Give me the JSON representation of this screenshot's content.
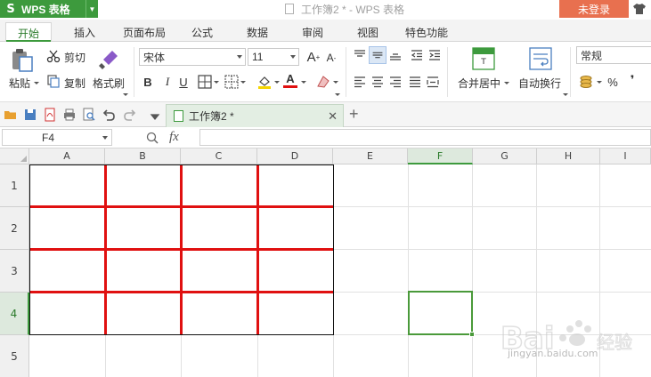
{
  "titlebar": {
    "app_name": "WPS 表格",
    "doc_title": "工作簿2 * - WPS 表格",
    "login_label": "未登录"
  },
  "menu": {
    "tabs": [
      "开始",
      "插入",
      "页面布局",
      "公式",
      "数据",
      "审阅",
      "视图",
      "特色功能"
    ],
    "active_index": 0
  },
  "ribbon": {
    "paste_label": "粘贴",
    "cut_label": "剪切",
    "copy_label": "复制",
    "format_painter_label": "格式刷",
    "font_name": "宋体",
    "font_size": "11",
    "bold": "B",
    "italic": "I",
    "underline": "U",
    "grow_font": "A",
    "shrink_font": "A",
    "merge_label": "合并居中",
    "wrap_label": "自动换行",
    "number_format": "常规",
    "percent": "%",
    "comma": "❜",
    "font_color": "#e01010",
    "fill_color": "#f5d500"
  },
  "doc_tabs": [
    {
      "label": "工作簿2 *",
      "active": true
    }
  ],
  "formula_bar": {
    "name_box": "F4",
    "fx_label": "fx",
    "formula": ""
  },
  "sheet": {
    "columns": [
      "A",
      "B",
      "C",
      "D",
      "E",
      "F",
      "G",
      "H",
      "I"
    ],
    "rows": [
      "1",
      "2",
      "3",
      "4",
      "5"
    ],
    "active_column": "F",
    "active_row": "4",
    "border_color": "#e01010",
    "selection_color": "#4a9a3a"
  },
  "watermark": {
    "text": "jingyan.baidu.com"
  }
}
